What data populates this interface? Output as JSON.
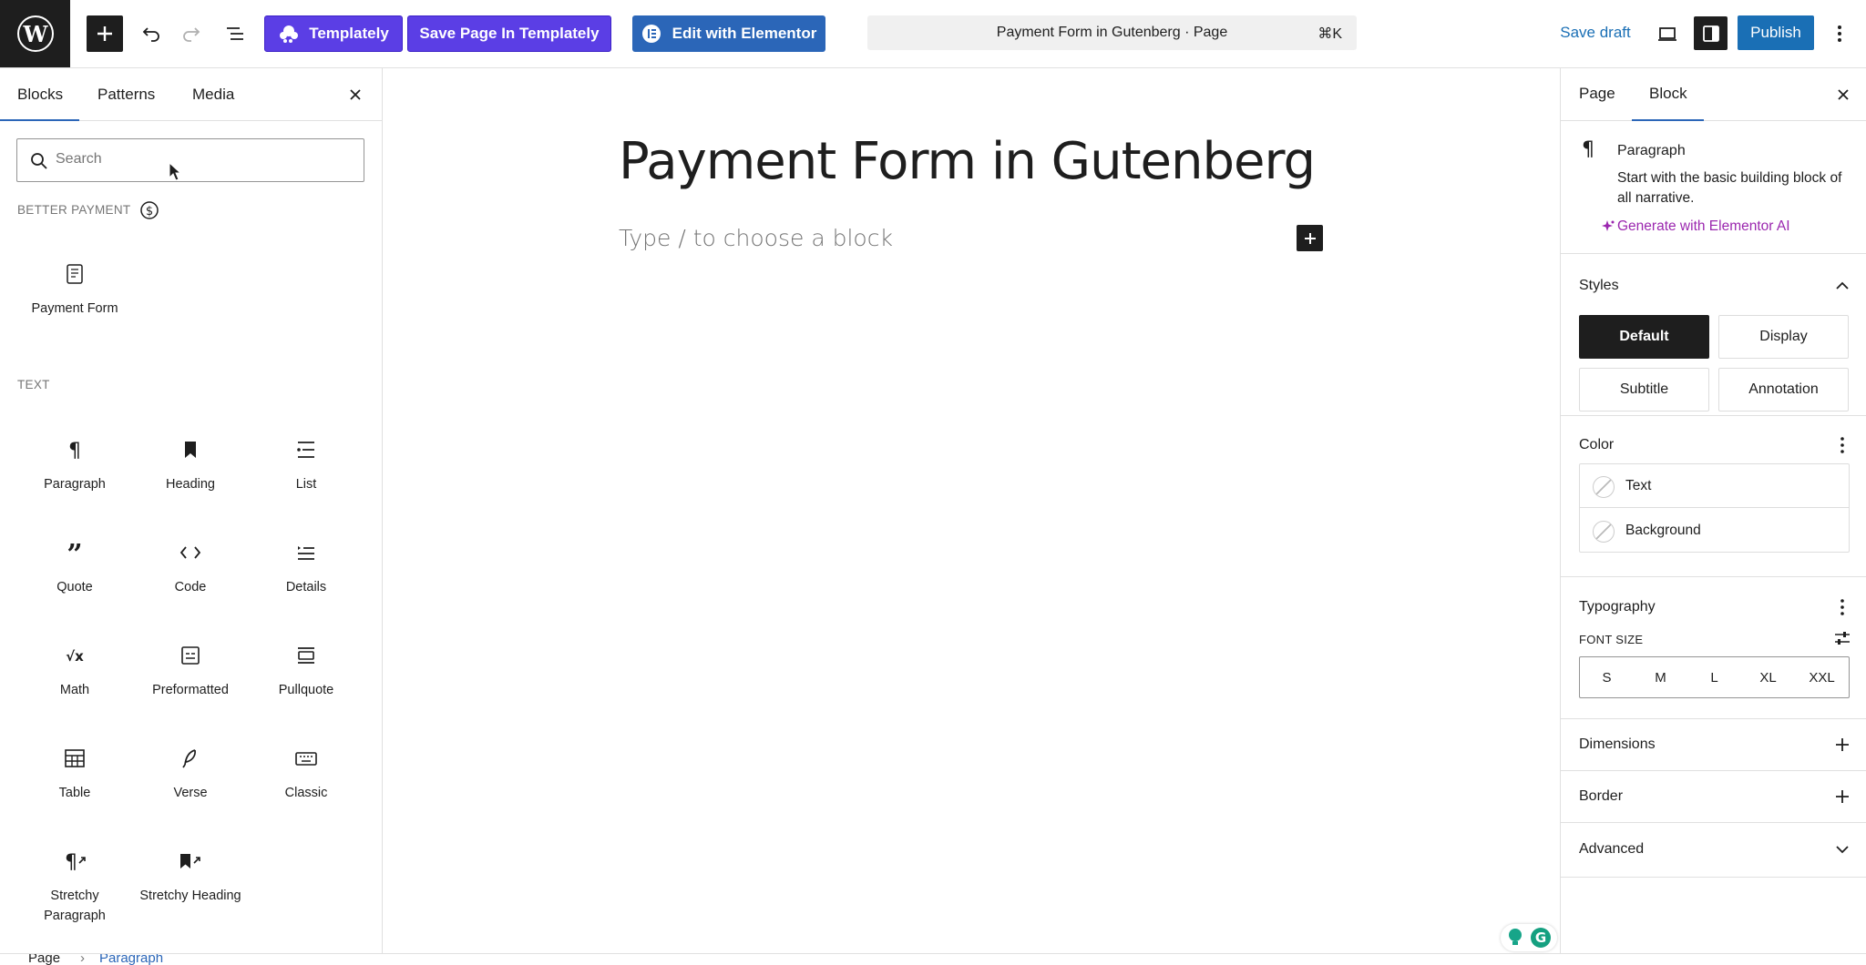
{
  "topbar": {
    "templately_label": "Templately",
    "save_templately_label": "Save Page In Templately",
    "elementor_label": "Edit with Elementor",
    "command_title": "Payment Form in Gutenberg · Page",
    "command_shortcut": "⌘K",
    "save_draft_label": "Save draft",
    "publish_label": "Publish"
  },
  "left_panel": {
    "tabs": [
      "Blocks",
      "Patterns",
      "Media"
    ],
    "search_placeholder": "Search",
    "categories": {
      "better_payment": "BETTER PAYMENT",
      "text": "TEXT"
    },
    "payment_blocks": [
      "Payment Form"
    ],
    "text_blocks": [
      "Paragraph",
      "Heading",
      "List",
      "Quote",
      "Code",
      "Details",
      "Math",
      "Preformatted",
      "Pullquote",
      "Table",
      "Verse",
      "Classic",
      "Stretchy Paragraph",
      "Stretchy Heading"
    ]
  },
  "canvas": {
    "title": "Payment Form in Gutenberg",
    "placeholder": "Type / to choose a block"
  },
  "right_panel": {
    "tabs": [
      "Page",
      "Block"
    ],
    "block_card": {
      "name": "Paragraph",
      "description": "Start with the basic building block of all narrative.",
      "ai_link": "Generate with Elementor AI"
    },
    "styles": {
      "title": "Styles",
      "options": [
        "Default",
        "Display",
        "Subtitle",
        "Annotation"
      ],
      "selected": "Default"
    },
    "color": {
      "title": "Color",
      "items": [
        "Text",
        "Background"
      ]
    },
    "typography": {
      "title": "Typography",
      "font_size_label": "FONT SIZE",
      "sizes": [
        "S",
        "M",
        "L",
        "XL",
        "XXL"
      ]
    },
    "dimensions_title": "Dimensions",
    "border_title": "Border",
    "advanced_title": "Advanced"
  },
  "footer": {
    "breadcrumb": [
      "Page",
      "Paragraph"
    ]
  },
  "colors": {
    "accent_blue": "#2b66b8",
    "templately_purple": "#5b3ee5",
    "elementor_ai_purple": "#9b27af",
    "dark": "#1e1e1e"
  }
}
